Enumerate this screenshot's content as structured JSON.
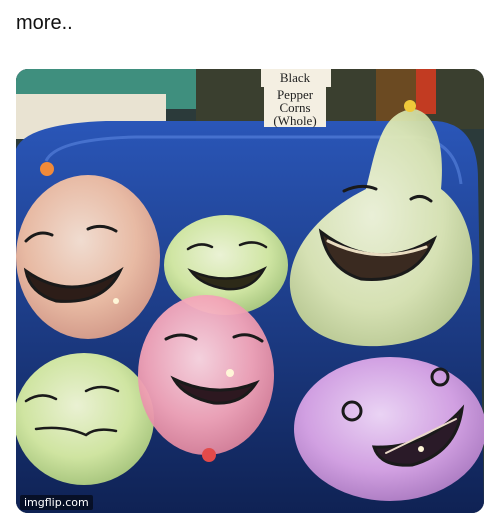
{
  "post": {
    "caption": "more..",
    "sign_lines": [
      "Black",
      "Pepper",
      "Corns",
      "(Whole)"
    ],
    "watermark": "imgflip.com"
  },
  "colors": {
    "tray_blue": "#1f3f8f",
    "balloon_peach": "#f2c2a6",
    "balloon_green": "#d7eea0",
    "balloon_pink": "#f5a5b8",
    "balloon_purple": "#d8a4e6"
  }
}
